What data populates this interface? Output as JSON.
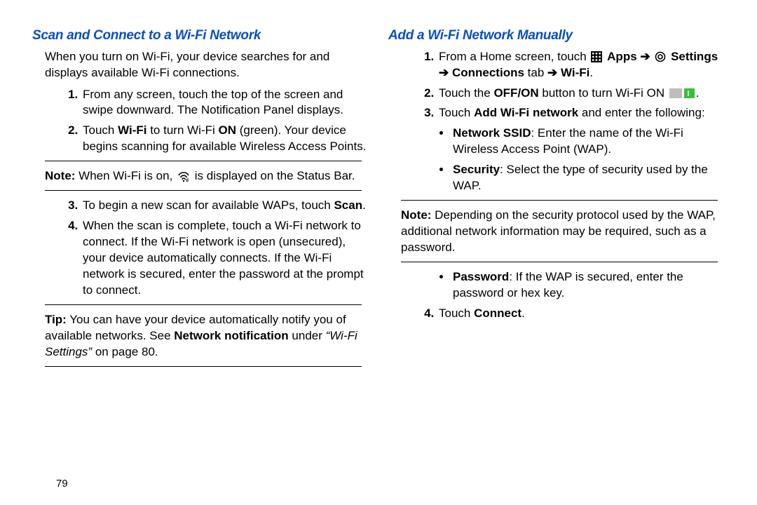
{
  "pageNumber": "79",
  "left": {
    "heading": "Scan and Connect to a Wi-Fi Network",
    "intro": "When you turn on Wi-Fi, your device searches for and displays available Wi-Fi connections.",
    "steps12": [
      "From any screen, touch the top of the screen and swipe downward. The Notification Panel displays.",
      {
        "pre": "Touch ",
        "b1": "Wi-Fi",
        "mid": " to turn Wi-Fi ",
        "b2": "ON",
        "post": " (green). Your device begins scanning for available Wireless Access Points."
      }
    ],
    "note1": {
      "lead": "Note:",
      "textA": " When Wi-Fi is on, ",
      "textB": " is displayed on the Status Bar."
    },
    "steps34": [
      {
        "pre": "To begin a new scan for available WAPs, touch ",
        "b": "Scan",
        "post": "."
      },
      "When the scan is complete, touch a Wi-Fi network to connect. If the Wi-Fi network is open (unsecured), your device automatically connects. If the Wi-Fi network is secured, enter the password at the prompt to connect."
    ],
    "tip": {
      "lead": "Tip:",
      "textA": " You can have your device automatically notify you of available networks. See ",
      "b": "Network notification",
      "textB": " under ",
      "i": "“Wi-Fi Settings”",
      "textC": " on page 80."
    }
  },
  "right": {
    "heading": "Add a Wi-Fi Network Manually",
    "step1": {
      "pre": "From a Home screen, touch ",
      "apps": "Apps",
      "arrow": " ➔ ",
      "settings": "Settings",
      "arrow2": " ➔ ",
      "connections": "Connections",
      "tab": " tab",
      "arrow3": " ➔ ",
      "wifi": "Wi-Fi",
      "end": "."
    },
    "step2": {
      "pre": "Touch the ",
      "b": "OFF/ON",
      "mid": " button to turn Wi-Fi ON ",
      "post": "."
    },
    "step3": {
      "pre": "Touch ",
      "b": "Add Wi-Fi network",
      "post": " and enter the following:"
    },
    "bullets1": [
      {
        "b": "Network SSID",
        "text": ": Enter the name of the Wi-Fi Wireless Access Point (WAP)."
      },
      {
        "b": "Security",
        "text": ": Select the type of security used by the WAP."
      }
    ],
    "note": {
      "lead": "Note:",
      "text": " Depending on the security protocol used by the WAP, additional network information may be required, such as a password."
    },
    "bullets2": [
      {
        "b": "Password",
        "text": ": If the WAP is secured, enter the password or hex key."
      }
    ],
    "step4": {
      "pre": "Touch ",
      "b": "Connect",
      "post": "."
    }
  }
}
